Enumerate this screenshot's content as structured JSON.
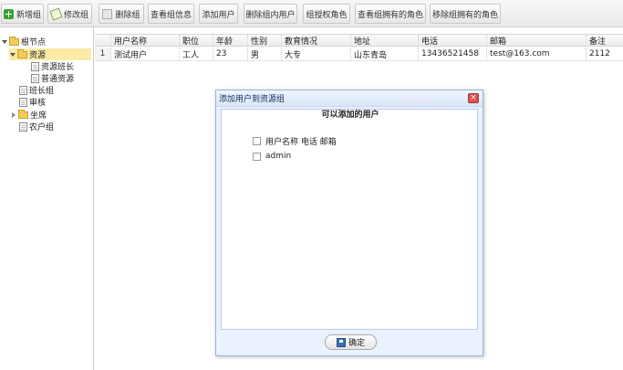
{
  "toolbar": {
    "new_group": "新增组",
    "edit_group": "修改组",
    "delete_group": "删除组",
    "view_group": "查看组信息",
    "add_user": "添加用户",
    "delete_user": "删除组内用户",
    "grant_role": "组授权角色",
    "view_roles": "查看组拥有的角色",
    "remove_roles": "移除组拥有的角色"
  },
  "tree": {
    "root": "根节点",
    "resources": "资源",
    "resource_leader": "资源班长",
    "normal_resource": "普通资源",
    "squad_leader": "班长组",
    "review": "审核",
    "agent": "坐席",
    "farmer": "农户组"
  },
  "grid": {
    "columns": [
      "用户名称",
      "职位",
      "年龄",
      "性别",
      "教育情况",
      "地址",
      "电话",
      "邮箱",
      "备注"
    ],
    "rows": [
      {
        "num": "1",
        "name": "测试用户",
        "position": "工人",
        "age": "23",
        "gender": "男",
        "education": "大专",
        "address": "山东青岛",
        "phone": "13436521458",
        "email": "test@163.com",
        "note": "2112"
      }
    ]
  },
  "dialog": {
    "title": "添加用户到资源组",
    "heading": "可以添加的用户",
    "header_option": "用户名称 电话 邮箱",
    "options": [
      "admin"
    ],
    "ok": "确定",
    "close": "×"
  }
}
